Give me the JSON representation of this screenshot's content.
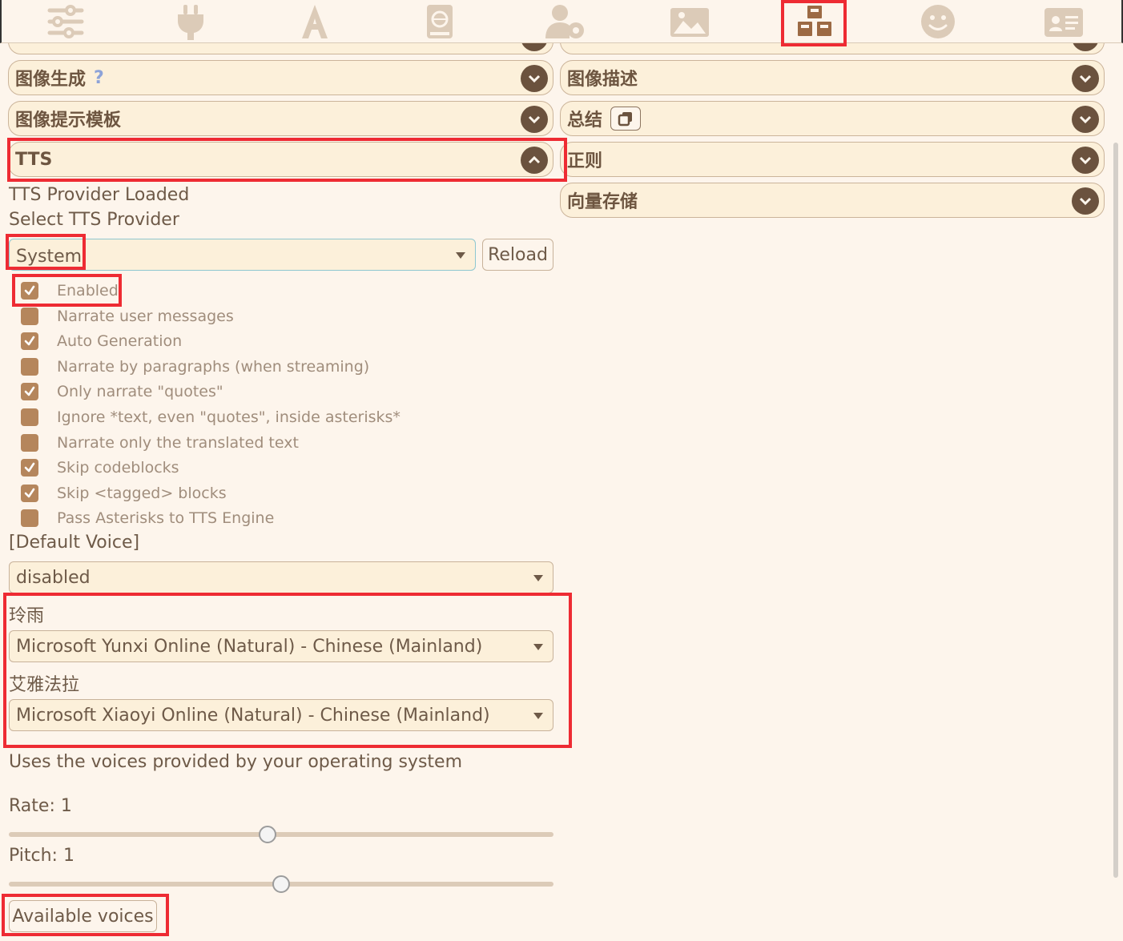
{
  "nav": {
    "icons": [
      "sliders-icon",
      "plug-icon",
      "font-icon",
      "book-globe-icon",
      "user-gear-icon",
      "image-icon",
      "cubes-icon",
      "smile-icon",
      "id-card-icon"
    ],
    "active": "cubes-icon"
  },
  "left_drawers": {
    "image_generation": "图像生成",
    "image_generation_help": "?",
    "image_prompt_templates": "图像提示模板",
    "tts": "TTS"
  },
  "right_drawers": {
    "image_captioning": "图像描述",
    "summarize": "总结",
    "regex": "正则",
    "vector_storage": "向量存储"
  },
  "tts": {
    "provider_status": "TTS Provider Loaded",
    "select_provider_label": "Select TTS Provider",
    "provider_value": "System",
    "reload_label": "Reload",
    "options": [
      {
        "label": "Enabled",
        "checked": true
      },
      {
        "label": "Narrate user messages",
        "checked": false
      },
      {
        "label": "Auto Generation",
        "checked": true
      },
      {
        "label": "Narrate by paragraphs (when streaming)",
        "checked": false
      },
      {
        "label": "Only narrate \"quotes\"",
        "checked": true
      },
      {
        "label": "Ignore *text, even \"quotes\", inside asterisks*",
        "checked": false
      },
      {
        "label": "Narrate only the translated text",
        "checked": false
      },
      {
        "label": "Skip codeblocks",
        "checked": true
      },
      {
        "label": "Skip <tagged> blocks",
        "checked": true
      },
      {
        "label": "Pass Asterisks to TTS Engine",
        "checked": false
      }
    ],
    "default_voice_label": "[Default Voice]",
    "default_voice_value": "disabled",
    "char1_name": "玲雨",
    "char1_voice": "Microsoft Yunxi Online (Natural) - Chinese (Mainland)",
    "char2_name": "艾雅法拉",
    "char2_voice": "Microsoft Xiaoyi Online (Natural) - Chinese (Mainland)",
    "description": "Uses the voices provided by your operating system",
    "rate_label": "Rate: 1",
    "rate_fraction": 0.475,
    "pitch_label": "Pitch: 1",
    "pitch_fraction": 0.5,
    "available_voices_label": "Available voices"
  },
  "colors": {
    "accent": "#6b523e",
    "highlight": "#ee2b33",
    "checkbox": "#b5865c"
  }
}
